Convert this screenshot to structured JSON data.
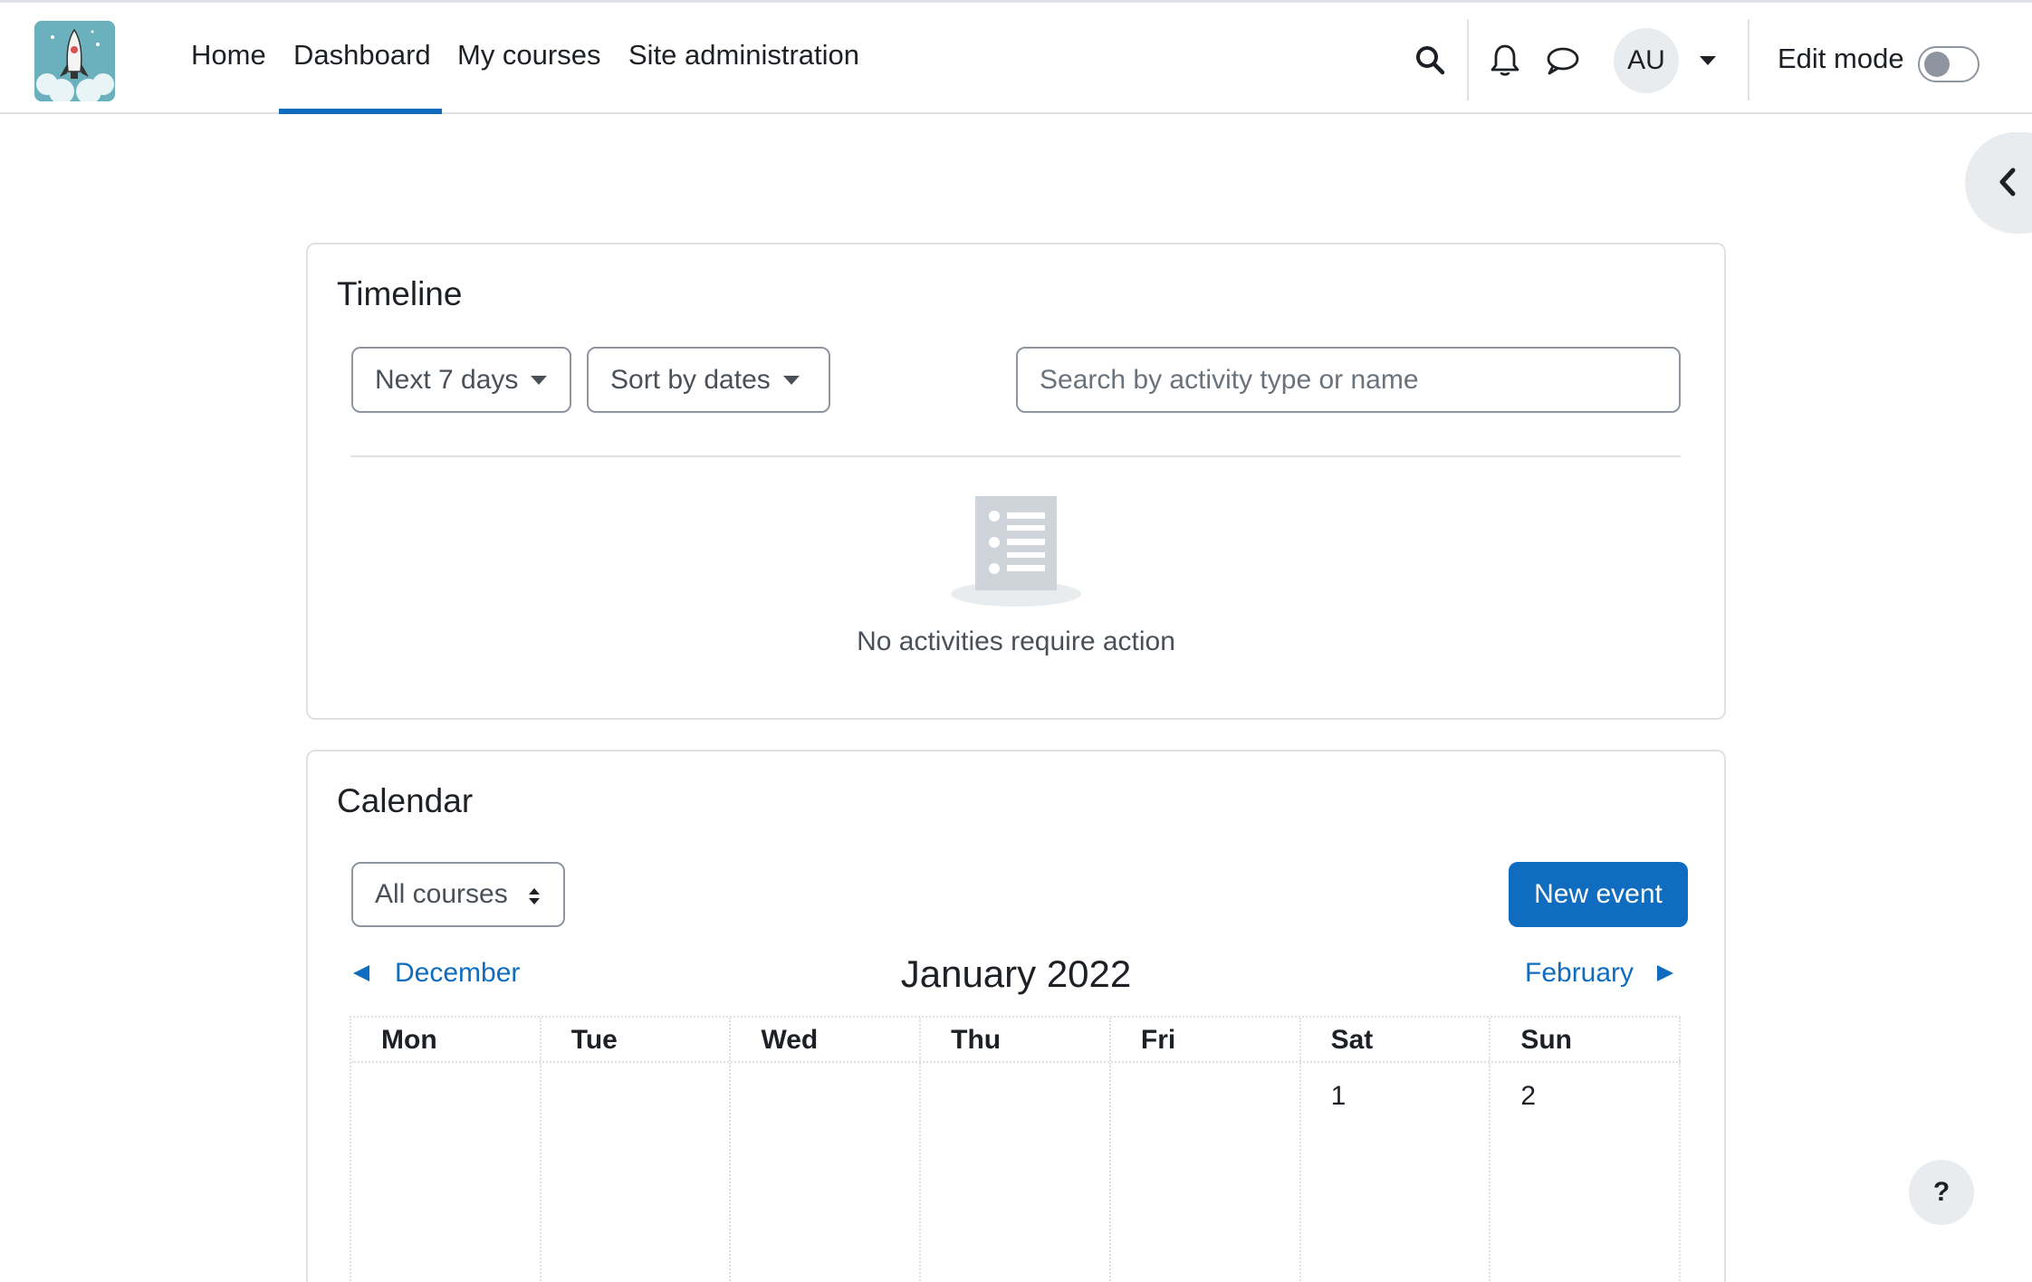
{
  "navbar": {
    "links": [
      {
        "label": "Home"
      },
      {
        "label": "Dashboard"
      },
      {
        "label": "My courses"
      },
      {
        "label": "Site administration"
      }
    ],
    "active_link": "Dashboard",
    "avatar_initials": "AU",
    "edit_mode_label": "Edit mode",
    "edit_mode_on": false,
    "icons": [
      "search-icon",
      "bell-icon",
      "chat-icon",
      "chevron-down-icon"
    ]
  },
  "timeline": {
    "title": "Timeline",
    "filter_label": "Next 7 days",
    "sort_label": "Sort by dates",
    "search_placeholder": "Search by activity type or name",
    "empty_message": "No activities require action"
  },
  "calendar": {
    "title": "Calendar",
    "course_filter": "All courses",
    "new_event_label": "New event",
    "prev_month": "December",
    "current_month": "January 2022",
    "next_month": "February",
    "weekdays": [
      "Mon",
      "Tue",
      "Wed",
      "Thu",
      "Fri",
      "Sat",
      "Sun"
    ],
    "first_week": [
      "",
      "",
      "",
      "",
      "",
      "1",
      "2"
    ]
  },
  "help_label": "?",
  "colors": {
    "accent": "#0f6cbf",
    "border": "#dee2e6",
    "muted_bg": "#e9ecef",
    "logo_bg": "#6ab0bd"
  }
}
